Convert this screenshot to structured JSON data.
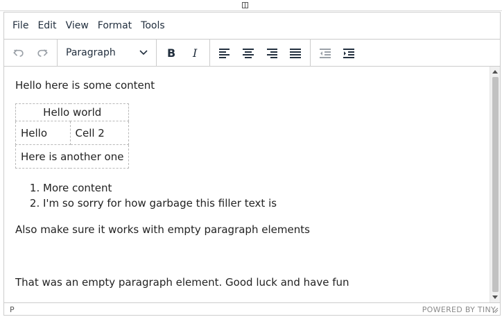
{
  "menubar": {
    "items": [
      "File",
      "Edit",
      "View",
      "Format",
      "Tools"
    ]
  },
  "toolbar": {
    "block_format": "Paragraph",
    "buttons": [
      "undo-icon",
      "redo-icon",
      "bold-icon",
      "italic-icon",
      "align-left-icon",
      "align-center-icon",
      "align-right-icon",
      "align-justify-icon",
      "outdent-icon",
      "indent-icon"
    ]
  },
  "content": {
    "paragraph1": "Hello here is some content",
    "table": {
      "caption": "Hello world",
      "rows": [
        [
          "Hello",
          "Cell 2"
        ],
        [
          "Here is another one"
        ]
      ]
    },
    "list": [
      "More content",
      "I'm so sorry for how garbage this filler text is"
    ],
    "paragraph2": "Also make sure it works with empty paragraph elements",
    "paragraph3": "That was an empty paragraph element. Good luck and have fun"
  },
  "statusbar": {
    "path": "P",
    "branding": "POWERED BY TINY"
  },
  "colors": {
    "border": "#cccccc",
    "text": "#222f3e",
    "scroll_thumb": "#c1c1c1"
  }
}
